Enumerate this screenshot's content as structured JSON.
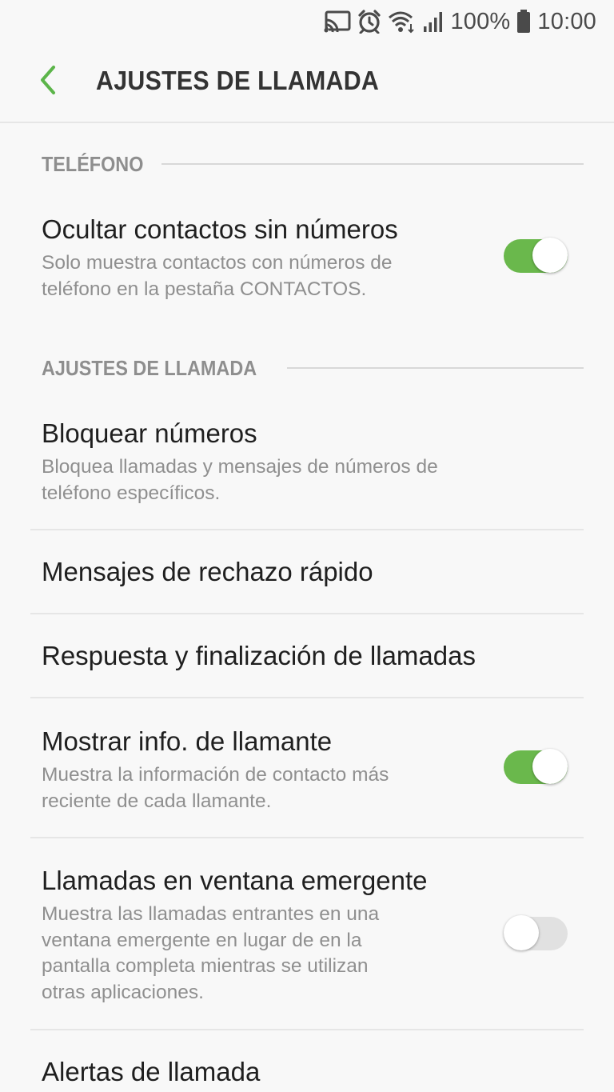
{
  "status_bar": {
    "icons": [
      "cast-icon",
      "alarm-icon",
      "wifi-icon",
      "signal-icon",
      "battery-icon"
    ],
    "battery": "100%",
    "time": "10:00"
  },
  "app_bar": {
    "back_icon": "chevron-left-icon",
    "title": "AJUSTES DE LLAMADA",
    "accent_color": "#5cb54a"
  },
  "sections": [
    {
      "header": "TELÉFONO",
      "items": [
        {
          "title": "Ocultar contactos sin números",
          "subtitle_lines": [
            "Solo muestra contactos con números de",
            "teléfono en la pestaña CONTACTOS."
          ],
          "toggle": true
        }
      ]
    },
    {
      "header": "AJUSTES DE LLAMADA",
      "items": [
        {
          "title": "Bloquear números",
          "subtitle_lines": [
            "Bloquea llamadas y mensajes de números de",
            "teléfono específicos."
          ]
        },
        {
          "title": "Mensajes de rechazo rápido"
        },
        {
          "title": "Respuesta y finalización de llamadas"
        },
        {
          "title": "Mostrar info. de llamante",
          "subtitle_lines": [
            "Muestra la información de contacto más",
            "reciente de cada llamante."
          ],
          "toggle": true
        },
        {
          "title": "Llamadas en ventana emergente",
          "subtitle_lines": [
            "Muestra las llamadas entrantes en una",
            "ventana emergente en lugar de en la",
            "pantalla completa mientras se utilizan",
            "otras aplicaciones."
          ],
          "toggle": false
        },
        {
          "title": "Alertas de llamada"
        }
      ]
    }
  ],
  "colors": {
    "toggle_on": "#6ab84c",
    "toggle_off": "#e1e1e1",
    "section_header": "#8e8e8e",
    "subtitle": "#8f8f8f"
  }
}
